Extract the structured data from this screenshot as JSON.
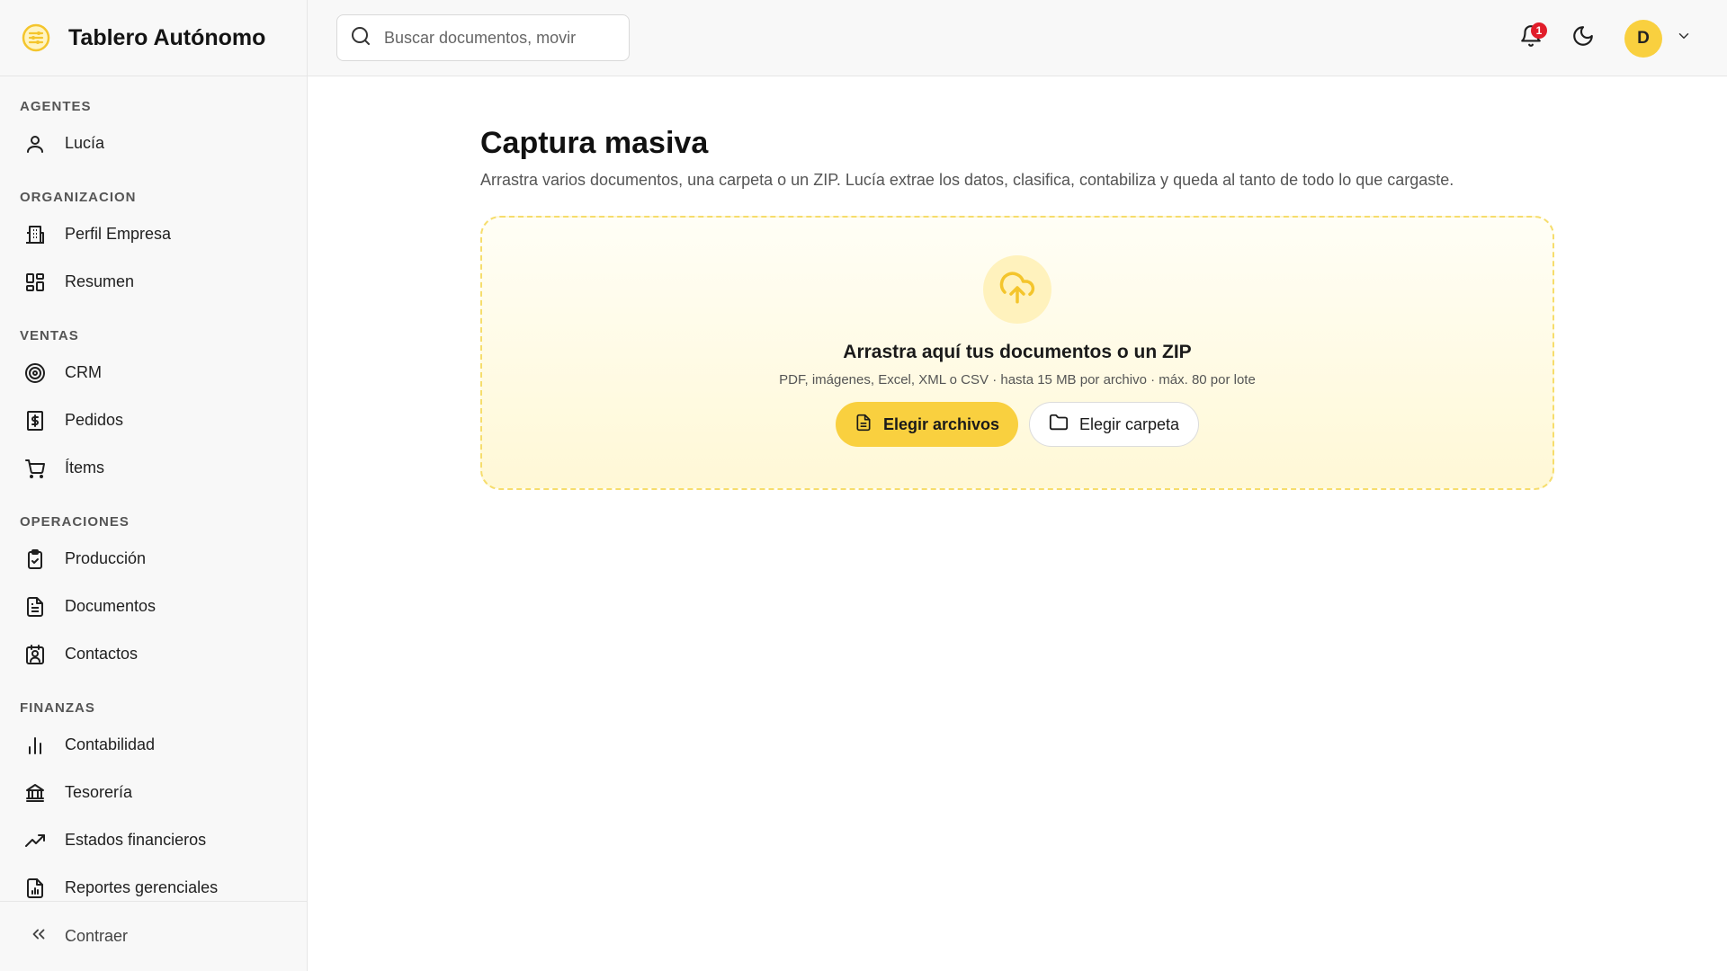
{
  "app": {
    "title": "Tablero Autónomo"
  },
  "sidebar": {
    "sections": [
      {
        "label": "AGENTES",
        "items": [
          {
            "label": "Lucía",
            "icon": "user-icon"
          }
        ]
      },
      {
        "label": "ORGANIZACION",
        "items": [
          {
            "label": "Perfil Empresa",
            "icon": "building-icon"
          },
          {
            "label": "Resumen",
            "icon": "dashboard-icon"
          }
        ]
      },
      {
        "label": "VENTAS",
        "items": [
          {
            "label": "CRM",
            "icon": "target-icon"
          },
          {
            "label": "Pedidos",
            "icon": "receipt-dollar-icon"
          },
          {
            "label": "Ítems",
            "icon": "cart-icon"
          }
        ]
      },
      {
        "label": "OPERACIONES",
        "items": [
          {
            "label": "Producción",
            "icon": "clipboard-check-icon"
          },
          {
            "label": "Documentos",
            "icon": "document-icon"
          },
          {
            "label": "Contactos",
            "icon": "contact-card-icon"
          }
        ]
      },
      {
        "label": "FINANZAS",
        "items": [
          {
            "label": "Contabilidad",
            "icon": "bar-chart-icon"
          },
          {
            "label": "Tesorería",
            "icon": "bank-icon"
          },
          {
            "label": "Estados financieros",
            "icon": "trending-up-icon"
          },
          {
            "label": "Reportes gerenciales",
            "icon": "report-icon"
          }
        ]
      }
    ],
    "collapse_label": "Contraer"
  },
  "topbar": {
    "search_placeholder": "Buscar documentos, movir",
    "notifications_count": "1",
    "avatar_initial": "D"
  },
  "main": {
    "title": "Captura masiva",
    "description": "Arrastra varios documentos, una carpeta o un ZIP. Lucía extrae los datos, clasifica, contabiliza y queda al tanto de todo lo que cargaste.",
    "dropzone": {
      "title": "Arrastra aquí tus documentos o un ZIP",
      "subtitle": "PDF, imágenes, Excel, XML o CSV · hasta 15 MB por archivo · máx. 80 por lote",
      "primary_button": "Elegir archivos",
      "secondary_button": "Elegir carpeta"
    }
  },
  "colors": {
    "accent": "#f9d03f",
    "badge": "#e11d2a",
    "dropzone_border": "#f6dd6c"
  }
}
